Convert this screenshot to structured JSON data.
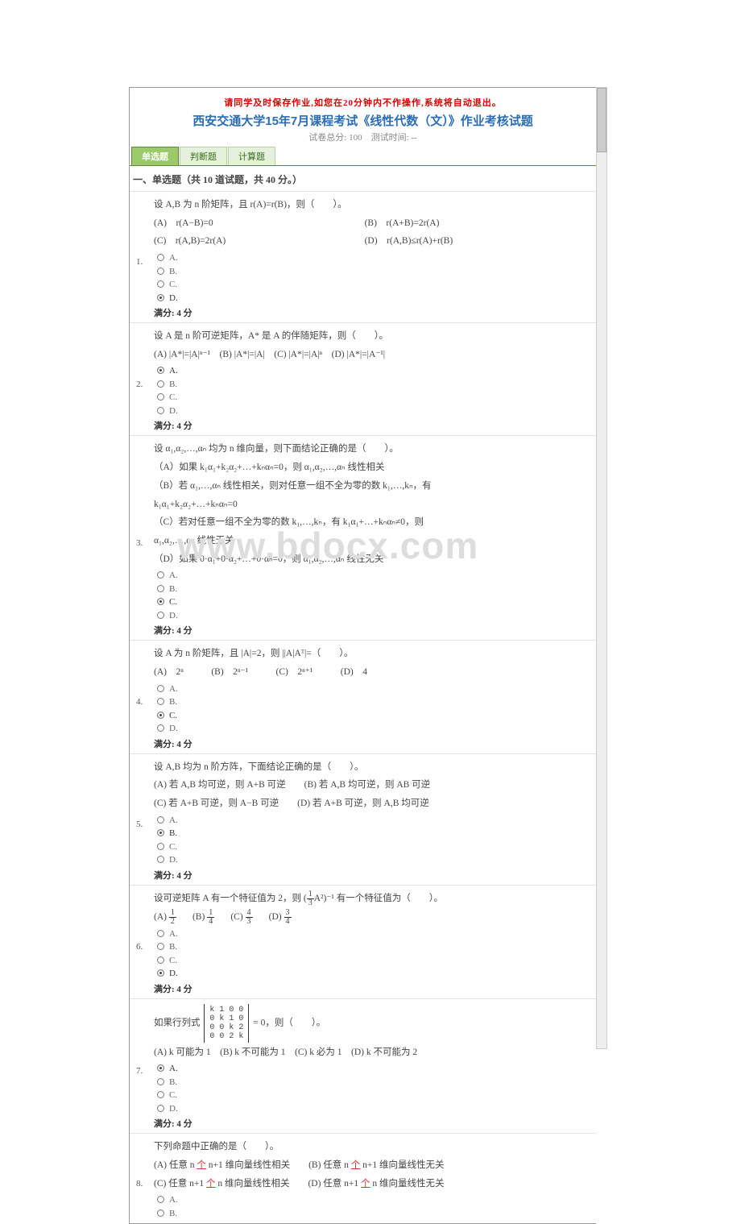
{
  "header": {
    "warning": "请同学及时保存作业,如您在20分钟内不作操作,系统将自动退出。",
    "title": "西安交通大学15年7月课程考试《线性代数（文）》作业考核试题",
    "subinfo": "试卷总分: 100　测试时间: --"
  },
  "tabs": [
    {
      "label": "单选题",
      "active": true
    },
    {
      "label": "判断题",
      "active": false
    },
    {
      "label": "计算题",
      "active": false
    }
  ],
  "section_head": "一、单选题（共 10 道试题，共 40 分。）",
  "score_label": "满分: 4 分",
  "opt_labels": {
    "A": "A.",
    "B": "B.",
    "C": "C.",
    "D": "D."
  },
  "questions": [
    {
      "num": "1.",
      "stem": "设 A,B 为 n 阶矩阵，且 r(A)=r(B)，则（　　）。",
      "rowA": "(A)　r(A−B)=0",
      "rowB": "(B)　r(A+B)=2r(A)",
      "rowC": "(C)　r(A,B)=2r(A)",
      "rowD": "(D)　r(A,B)≤r(A)+r(B)",
      "selected": "D"
    },
    {
      "num": "2.",
      "stem": "设 A 是 n 阶可逆矩阵，A* 是 A 的伴随矩阵，则（　　）。",
      "row": "(A) |A*|=|A|ⁿ⁻¹　(B) |A*|=|A|　(C) |A*|=|A|ⁿ　(D) |A*|=|A⁻¹|",
      "selected": "A"
    },
    {
      "num": "3.",
      "stem": "设 α₁,α₂,…,αₙ 均为 n 维向量，则下面结论正确的是（　　）。",
      "lineA": "（A）如果 k₁α₁+k₂α₂+…+kₙαₙ=0，则 α₁,α₂,…,αₙ 线性相关",
      "lineB1": "（B）若 α₁,…,αₙ 线性相关，则对任意一组不全为零的数 k₁,…,kₙ，有",
      "lineB2": "k₁α₁+k₂α₂+…+kₙαₙ=0",
      "lineC1": "（C）若对任意一组不全为零的数 k₁,…,kₙ，有 k₁α₁+…+kₙαₙ≠0，则",
      "lineC2": "α₁,α₂,…,αₙ 线性无关",
      "lineD": "（D）如果 0·α₁+0·α₂+…+0·αₙ=0，则 α₁,α₂,…,αₙ 线性无关",
      "selected": "C"
    },
    {
      "num": "4.",
      "stem": "设 A 为 n 阶矩阵，且 |A|=2，则 ||A|Aᵀ|=（　　）。",
      "row": "(A) 2ⁿ　　　(B) 2ⁿ⁻¹　　　(C) 2ⁿ⁺¹　　　(D) 4",
      "selected": "C"
    },
    {
      "num": "5.",
      "stem": "设 A,B 均为 n 阶方阵，下面结论正确的是（　　）。",
      "rowAB": "(A) 若 A,B 均可逆，则 A+B 可逆　　(B) 若 A,B 均可逆，则 AB 可逆",
      "rowCD": "(C) 若 A+B 可逆，则 A−B 可逆　　(D) 若 A+B 可逆，则 A,B 均可逆",
      "selected": "B"
    },
    {
      "num": "6.",
      "stem_before": "设可逆矩阵 A 有一个特征值为 2，则 (",
      "stem_after": "A²)⁻¹ 有一个特征值为（　　）。",
      "frac_n": "1",
      "frac_d": "3",
      "cA_n": "1",
      "cA_d": "2",
      "cB_n": "1",
      "cB_d": "4",
      "cC_n": "4",
      "cC_d": "3",
      "cD_n": "3",
      "cD_d": "4",
      "selected": "D"
    },
    {
      "num": "7.",
      "stem_before": "如果行列式 ",
      "stem_after": " = 0，则（　　）。",
      "matrix": "k 1 0 0\n0 k 1 0\n0 0 k 2\n0 0 2 k",
      "row": "(A) k 可能为 1　(B) k 不可能为 1　(C) k 必为 1　(D) k 不可能为 2",
      "selected": "A"
    },
    {
      "num": "8.",
      "stem": "下列命题中正确的是（　　）。",
      "rowAB_a": "(A) 任意 n ",
      "rowAB_mid": "个",
      "rowAB_b": " n+1 维向量线性相关　　(B) 任意 n ",
      "rowAB_b2": " n+1 维向量线性无关",
      "rowCD_a": "(C) 任意 n+1 ",
      "rowCD_b": " n 维向量线性相关　　(D) 任意 n+1 ",
      "rowCD_b2": " n 维向量线性无关",
      "selected": ""
    }
  ],
  "watermark": "www.bdocx.com"
}
